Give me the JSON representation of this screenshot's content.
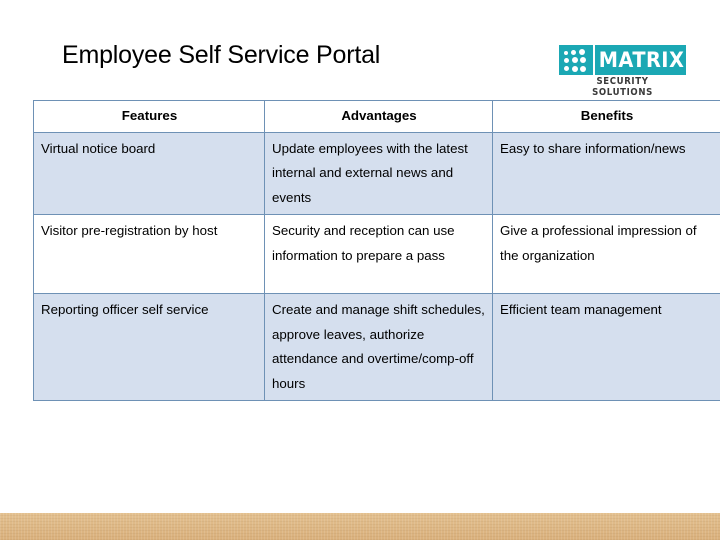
{
  "slide": {
    "title": "Employee Self Service Portal"
  },
  "logo": {
    "name": "matrix-logo",
    "word": "MATRIX",
    "tagline": "SECURITY SOLUTIONS",
    "brand_color": "#1ba8b4",
    "tagline_color": "#3a3a3a"
  },
  "table": {
    "headers": [
      "Features",
      "Advantages",
      "Benefits"
    ],
    "border_color": "#6e91b5",
    "shade_color": "#d5dfee",
    "rows": [
      {
        "shaded": true,
        "features": "Virtual notice board",
        "advantages": "Update employees with the latest internal and external news and events",
        "benefits": "Easy to share information/news"
      },
      {
        "shaded": false,
        "features": "Visitor pre-registration by host",
        "advantages": "Security and reception can use information to prepare a pass",
        "benefits": "Give a professional impression of the organization"
      },
      {
        "shaded": true,
        "features": "Reporting officer self service",
        "advantages": "Create and manage shift schedules, approve leaves, authorize attendance and overtime/comp-off hours",
        "benefits": "Efficient team management"
      }
    ]
  },
  "bottom_band": {
    "color": "#deb887"
  }
}
